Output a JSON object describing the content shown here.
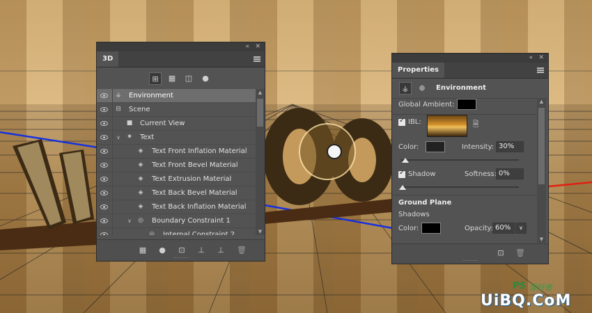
{
  "panel_3d": {
    "title": "3D",
    "collapse_glyph": "«",
    "close_glyph": "✕",
    "filter_icons": [
      "scene-filter-icon",
      "mesh-filter-icon",
      "material-filter-icon",
      "light-filter-icon"
    ],
    "layers": [
      {
        "label": "Environment",
        "icon": "environment-icon",
        "selected": true
      },
      {
        "label": "Scene",
        "icon": "scene-icon"
      },
      {
        "label": "Current View",
        "icon": "camera-icon"
      },
      {
        "label": "Text",
        "icon": "mesh-icon",
        "expanded": true
      },
      {
        "label": "Text Front Inflation Material",
        "icon": "material-icon"
      },
      {
        "label": "Text Front Bevel Material",
        "icon": "material-icon"
      },
      {
        "label": "Text Extrusion Material",
        "icon": "material-icon"
      },
      {
        "label": "Text Back Bevel Material",
        "icon": "material-icon"
      },
      {
        "label": "Text Back Inflation Material",
        "icon": "material-icon"
      },
      {
        "label": "Boundary Constraint 1",
        "icon": "constraint-icon",
        "expanded": true
      },
      {
        "label": "Internal Constraint 2",
        "icon": "constraint-icon"
      }
    ],
    "bottom_icons": [
      "new-mesh-icon",
      "new-light-icon",
      "render-icon",
      "ground-plane-icon",
      "drop-to-plane-icon",
      "trash-icon"
    ]
  },
  "panel_properties": {
    "tab": "Properties",
    "collapse_glyph": "«",
    "close_glyph": "✕",
    "header_title": "Environment",
    "global_ambient_label": "Global Ambient:",
    "ibl_label": "IBL:",
    "color_label": "Color:",
    "intensity_label": "Intensity:",
    "intensity_value": "30%",
    "shadow_label": "Shadow",
    "softness_label": "Softness:",
    "softness_value": "0%",
    "ground_plane_label": "Ground Plane",
    "shadows_label": "Shadows",
    "shadow_color_label": "Color:",
    "opacity_label": "Opacity:",
    "opacity_value": "60%",
    "colors": {
      "global_ambient": "#000000",
      "ibl_color": "#222222",
      "shadow_color": "#000000"
    }
  },
  "watermark": {
    "site": "UiBQ.CoM",
    "brand": "PS",
    "brand_cn": "爱好者"
  }
}
